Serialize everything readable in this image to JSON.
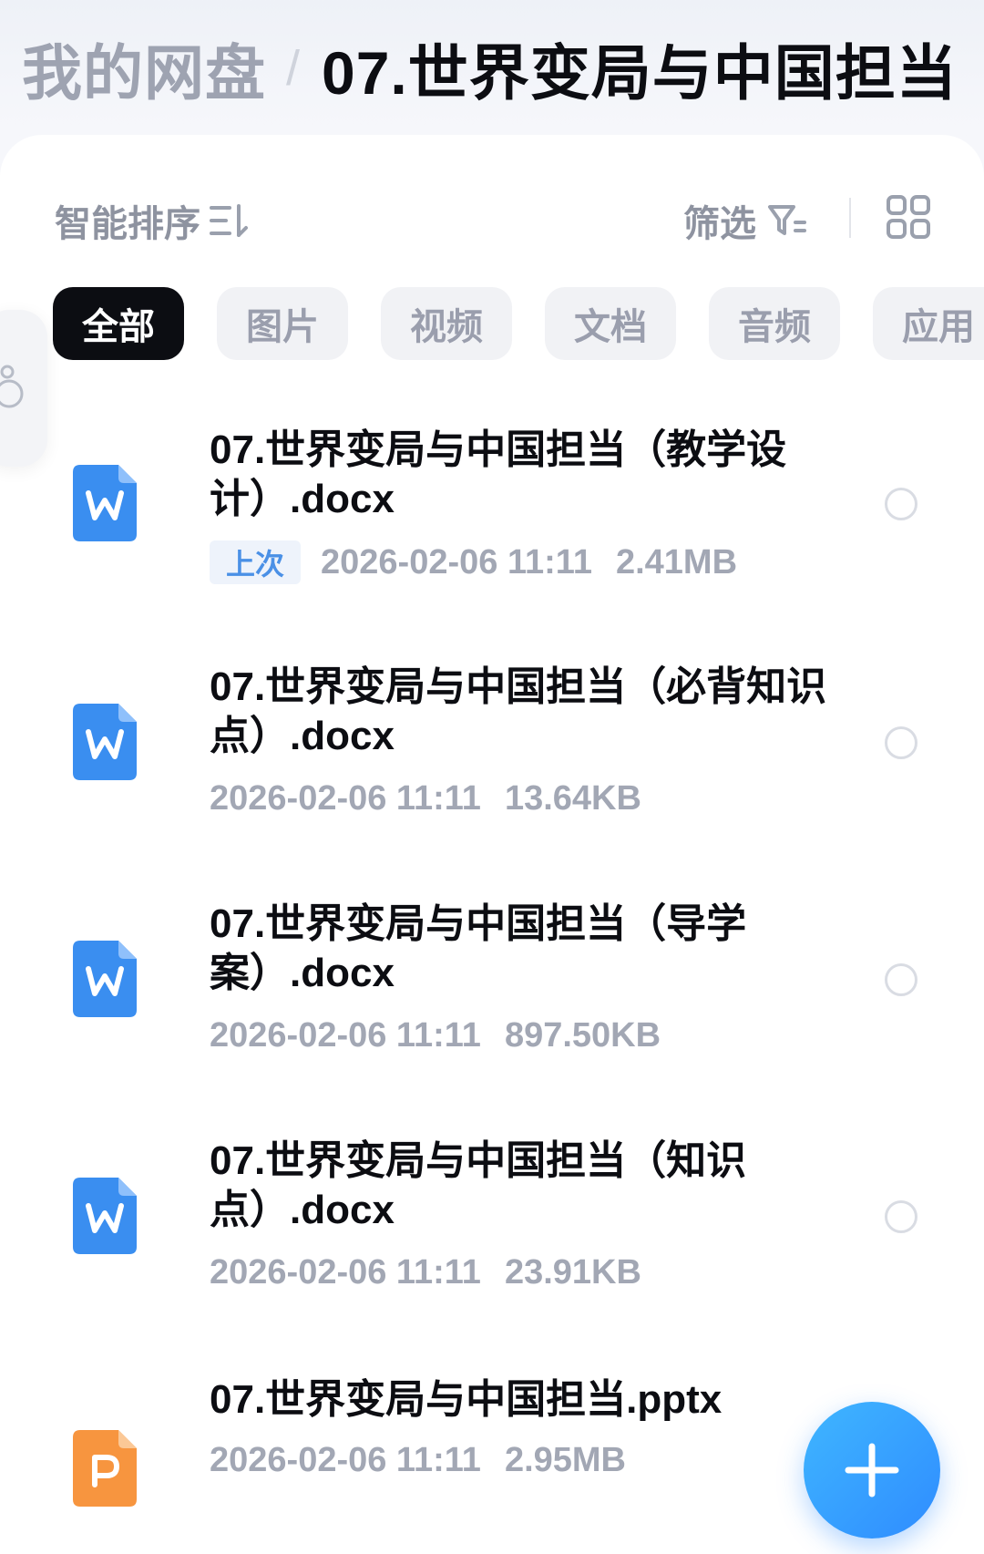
{
  "header": {
    "root_label": "我的网盘",
    "separator": "/",
    "current_folder": "07.世界变局与中国担当"
  },
  "toolbar": {
    "sort_label": "智能排序",
    "filter_label": "筛选",
    "sort_icon": "sort-icon",
    "filter_icon": "filter-icon",
    "grid_icon": "grid-view-icon"
  },
  "tabs": [
    {
      "label": "全部",
      "active": true
    },
    {
      "label": "图片",
      "active": false
    },
    {
      "label": "视频",
      "active": false
    },
    {
      "label": "文档",
      "active": false
    },
    {
      "label": "音频",
      "active": false
    },
    {
      "label": "应用",
      "active": false
    }
  ],
  "files": [
    {
      "name": "07.世界变局与中国担当（教学设计）.docx",
      "type": "word",
      "badge": "上次",
      "date": "2026-02-06 11:11",
      "size": "2.41MB"
    },
    {
      "name": "07.世界变局与中国担当（必背知识点）.docx",
      "type": "word",
      "badge": "",
      "date": "2026-02-06 11:11",
      "size": "13.64KB"
    },
    {
      "name": "07.世界变局与中国担当（导学案）.docx",
      "type": "word",
      "badge": "",
      "date": "2026-02-06 11:11",
      "size": "897.50KB"
    },
    {
      "name": "07.世界变局与中国担当（知识点）.docx",
      "type": "word",
      "badge": "",
      "date": "2026-02-06 11:11",
      "size": "23.91KB"
    },
    {
      "name": "07.世界变局与中国担当.pptx",
      "type": "ppt",
      "badge": "",
      "date": "2026-02-06 11:11",
      "size": "2.95MB"
    }
  ],
  "colors": {
    "word_icon": "#3a8ef0",
    "ppt_icon": "#f7953f",
    "fab": "#2f8cff",
    "active_tab": "#0c0d12"
  },
  "fab": {
    "icon": "plus-icon"
  }
}
